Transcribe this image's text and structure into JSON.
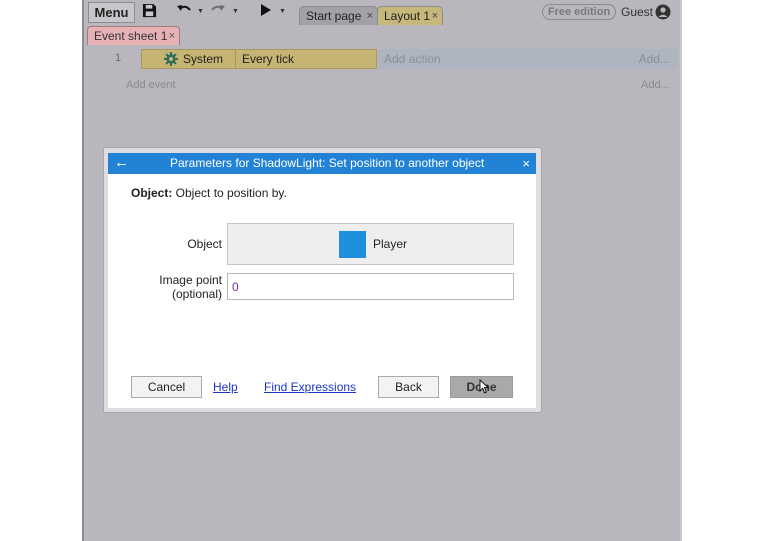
{
  "toolbar": {
    "menu_label": "Menu",
    "tabs": [
      {
        "label": "Start page",
        "close": "×"
      },
      {
        "label": "Layout 1",
        "close": "×"
      }
    ],
    "edition_badge": "Free edition",
    "user_label": "Guest"
  },
  "event_sheet": {
    "tab_label": "Event sheet 1",
    "tab_close": "×",
    "events": [
      {
        "number": "1",
        "condition_object": "System",
        "condition_text": "Every tick",
        "add_action_label": "Add action",
        "add_label": "Add..."
      }
    ],
    "add_event_label": "Add event",
    "add_label": "Add..."
  },
  "dialog": {
    "title": "Parameters for ShadowLight: Set position to another object",
    "back_glyph": "←",
    "close_glyph": "×",
    "description_bold": "Object:",
    "description_text": " Object to position by.",
    "object_label": "Object",
    "object_value": "Player",
    "object_color": "#1f8fdd",
    "image_point_label_1": "Image point",
    "image_point_label_2": "(optional)",
    "image_point_value": "0",
    "buttons": {
      "cancel": "Cancel",
      "help": "Help",
      "find_expressions": "Find Expressions",
      "back": "Back",
      "done": "Done"
    }
  },
  "colors": {
    "title_bar": "#2283d6",
    "condition_bg": "#c5b472",
    "sheet_tab": "#e6b1b5",
    "link": "#1a35c8",
    "expression_text": "#7a2db0"
  }
}
